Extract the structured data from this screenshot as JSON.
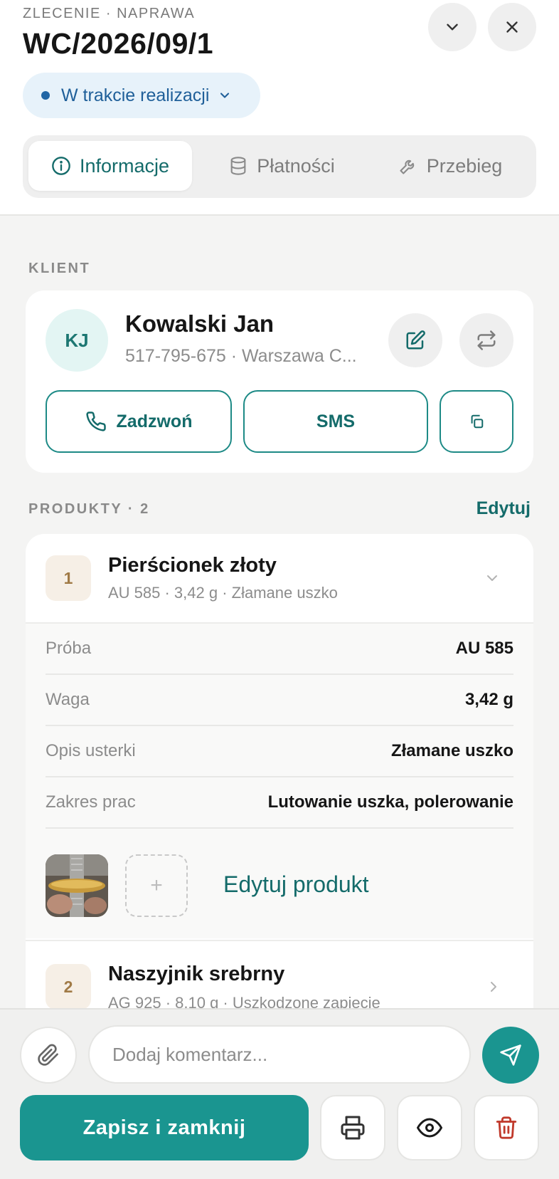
{
  "header": {
    "eyebrow": "ZLECENIE · NAPRAWA",
    "order_number": "WC/2026/09/1",
    "status": "W trakcie realizacji",
    "status_color": "#2166a5"
  },
  "tabs": [
    {
      "label": "Informacje",
      "icon": "info-icon",
      "active": true
    },
    {
      "label": "Płatności",
      "icon": "database-icon",
      "active": false
    },
    {
      "label": "Przebieg",
      "icon": "wrench-icon",
      "active": false
    }
  ],
  "client": {
    "section_label": "KLIENT",
    "initials": "KJ",
    "name": "Kowalski Jan",
    "meta": "517-795-675 · Warszawa C...",
    "call_label": "Zadzwoń",
    "sms_label": "SMS"
  },
  "products": {
    "section_label": "PRODUKTY · 2",
    "edit_label": "Edytuj",
    "items": [
      {
        "number": "1",
        "name": "Pierścionek złoty",
        "meta": "AU 585 · 3,42 g · Złamane uszko",
        "details": [
          {
            "key": "Próba",
            "value": "AU 585"
          },
          {
            "key": "Waga",
            "value": "3,42 g"
          },
          {
            "key": "Opis usterki",
            "value": "Złamane uszko"
          },
          {
            "key": "Zakres prac",
            "value": "Lutowanie uszka, polerowanie"
          }
        ],
        "add_photo_symbol": "+",
        "edit_product_label": "Edytuj produkt"
      },
      {
        "number": "2",
        "name": "Naszyjnik srebrny",
        "meta": "AG 925 · 8,10 g · Uszkodzone zapięcie"
      }
    ]
  },
  "footer": {
    "comment_placeholder": "Dodaj komentarz...",
    "save_label": "Zapisz i zamknij"
  },
  "colors": {
    "accent": "#1a9590",
    "accent_dark": "#146b6a",
    "danger": "#c0392b"
  }
}
